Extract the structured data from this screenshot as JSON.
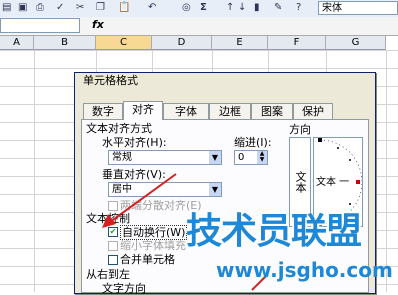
{
  "toolbar": {
    "font_name": "宋体"
  },
  "formula_bar": {
    "fx_label": "fx"
  },
  "columns": [
    "A",
    "B",
    "C",
    "D",
    "E",
    "F",
    "G"
  ],
  "dialog": {
    "title": "单元格格式",
    "tabs": [
      "数字",
      "对齐",
      "字体",
      "边框",
      "图案",
      "保护"
    ],
    "active_tab": "对齐",
    "text_align_section": "文本对齐方式",
    "horizontal_label": "水平对齐(H):",
    "horizontal_value": "常规",
    "vertical_label": "垂直对齐(V):",
    "vertical_value": "居中",
    "indent_label": "缩进(I):",
    "indent_value": "0",
    "justify_distributed": "两端分散对齐(E)",
    "text_control_section": "文本控制",
    "wrap_text": "自动换行(W)",
    "wrap_text_checked": true,
    "shrink_to_fit": "缩小字体填充",
    "merge_cells": "合并单元格",
    "rtl_section": "从右到左",
    "text_direction": "文字方向",
    "orientation_section": "方向",
    "orientation_vertical_text": "文本",
    "orientation_dial_text": "文本 一"
  },
  "watermark": {
    "title": "技术员联盟",
    "url": "www.jsgho.com"
  },
  "colors": {
    "accent": "#0a246a",
    "watermark_blue": "#1e88d8",
    "arrow_red": "#d42020"
  }
}
